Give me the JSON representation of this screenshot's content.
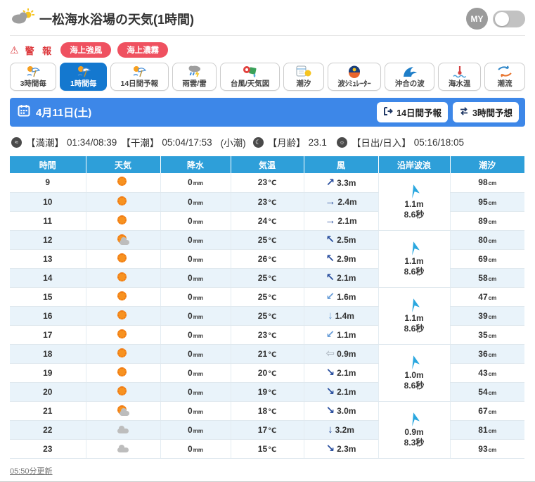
{
  "header": {
    "title": "一松海水浴場の天気(1時間)",
    "my_label": "MY"
  },
  "alerts": {
    "warning_label": "警 報",
    "badges": [
      "海上強風",
      "海上濃霧"
    ]
  },
  "tabs": [
    {
      "label": "3時間毎",
      "icon": "forecast-sun-umbrella-icon",
      "active": false
    },
    {
      "label": "1時間毎",
      "icon": "forecast-sun-umbrella-icon",
      "active": true
    },
    {
      "label": "14日間予報",
      "icon": "forecast-sun-umbrella-icon",
      "active": false
    },
    {
      "label": "雨雲/雷",
      "icon": "rain-cloud-thunder-icon",
      "active": false
    },
    {
      "label": "台風/天気図",
      "icon": "typhoon-map-icon",
      "active": false
    },
    {
      "label": "潮汐",
      "icon": "tide-calendar-icon",
      "active": false
    },
    {
      "label": "波ｼﾐｭﾚｰﾀｰ",
      "icon": "wave-simulator-icon",
      "active": false
    },
    {
      "label": "沖合の波",
      "icon": "offshore-wave-icon",
      "active": false
    },
    {
      "label": "海水温",
      "icon": "sea-temperature-icon",
      "active": false
    },
    {
      "label": "潮流",
      "icon": "current-icon",
      "active": false
    }
  ],
  "date_bar": {
    "date": "4月11日(土)",
    "buttons": [
      "14日間予報",
      "3時間予想"
    ]
  },
  "tide_info": {
    "high_label": "【満潮】",
    "high": "01:34/08:39",
    "low_label": "【干潮】",
    "low": "05:04/17:53",
    "phase": "(小潮)",
    "moon_label": "【月齢】",
    "moon": "23.1",
    "sun_label": "【日出/日入】",
    "sun": "05:16/18:05"
  },
  "units": {
    "precip": "mm",
    "temp": "℃",
    "wind": "m",
    "tide": "cm"
  },
  "table": {
    "headers": [
      "時間",
      "天気",
      "降水",
      "気温",
      "風",
      "沿岸波浪",
      "潮汐"
    ],
    "rows": [
      {
        "hour": "9",
        "weather": "sunny",
        "precip": "0",
        "temp": "23",
        "wind_dir": "↗",
        "wind_speed": "3.3",
        "wind_level": "strong",
        "tide": "98"
      },
      {
        "hour": "10",
        "weather": "sunny",
        "precip": "0",
        "temp": "23",
        "wind_dir": "→",
        "wind_speed": "2.4",
        "wind_level": "strong",
        "tide": "95"
      },
      {
        "hour": "11",
        "weather": "sunny",
        "precip": "0",
        "temp": "24",
        "wind_dir": "→",
        "wind_speed": "2.1",
        "wind_level": "strong",
        "tide": "89"
      },
      {
        "hour": "12",
        "weather": "sun-cloud",
        "precip": "0",
        "temp": "25",
        "wind_dir": "↖",
        "wind_speed": "2.5",
        "wind_level": "strong",
        "tide": "80"
      },
      {
        "hour": "13",
        "weather": "sunny",
        "precip": "0",
        "temp": "26",
        "wind_dir": "↖",
        "wind_speed": "2.9",
        "wind_level": "strong",
        "tide": "69"
      },
      {
        "hour": "14",
        "weather": "sunny",
        "precip": "0",
        "temp": "25",
        "wind_dir": "↖",
        "wind_speed": "2.1",
        "wind_level": "strong",
        "tide": "58"
      },
      {
        "hour": "15",
        "weather": "sunny",
        "precip": "0",
        "temp": "25",
        "wind_dir": "↙",
        "wind_speed": "1.6",
        "wind_level": "mid",
        "tide": "47"
      },
      {
        "hour": "16",
        "weather": "sunny",
        "precip": "0",
        "temp": "25",
        "wind_dir": "↓",
        "wind_speed": "1.4",
        "wind_level": "mid",
        "tide": "39"
      },
      {
        "hour": "17",
        "weather": "sunny",
        "precip": "0",
        "temp": "23",
        "wind_dir": "↙",
        "wind_speed": "1.1",
        "wind_level": "mid",
        "tide": "35"
      },
      {
        "hour": "18",
        "weather": "sunny",
        "precip": "0",
        "temp": "21",
        "wind_dir": "⇦",
        "wind_speed": "0.9",
        "wind_level": "weak",
        "tide": "36"
      },
      {
        "hour": "19",
        "weather": "sunny",
        "precip": "0",
        "temp": "20",
        "wind_dir": "↘",
        "wind_speed": "2.1",
        "wind_level": "strong",
        "tide": "43"
      },
      {
        "hour": "20",
        "weather": "sunny",
        "precip": "0",
        "temp": "19",
        "wind_dir": "↘",
        "wind_speed": "2.1",
        "wind_level": "strong",
        "tide": "54"
      },
      {
        "hour": "21",
        "weather": "sun-cloud",
        "precip": "0",
        "temp": "18",
        "wind_dir": "↘",
        "wind_speed": "3.0",
        "wind_level": "strong",
        "tide": "67"
      },
      {
        "hour": "22",
        "weather": "cloudy",
        "precip": "0",
        "temp": "17",
        "wind_dir": "↓",
        "wind_speed": "3.2",
        "wind_level": "strong",
        "tide": "81"
      },
      {
        "hour": "23",
        "weather": "cloudy",
        "precip": "0",
        "temp": "15",
        "wind_dir": "↘",
        "wind_speed": "2.3",
        "wind_level": "strong",
        "tide": "93"
      }
    ],
    "wave_groups": [
      {
        "height": "1.1m",
        "period": "8.6秒"
      },
      {
        "height": "1.1m",
        "period": "8.6秒"
      },
      {
        "height": "1.1m",
        "period": "8.6秒"
      },
      {
        "height": "1.0m",
        "period": "8.6秒"
      },
      {
        "height": "0.9m",
        "period": "8.3秒"
      }
    ]
  },
  "footer": {
    "updated": "05:50分更新"
  },
  "colors": {
    "accent_blue": "#3d87e8",
    "table_header_blue": "#2e9fd9",
    "active_tab_blue": "#1478cf",
    "badge_red": "#ef5160",
    "warning_red": "#dd3a3e"
  }
}
